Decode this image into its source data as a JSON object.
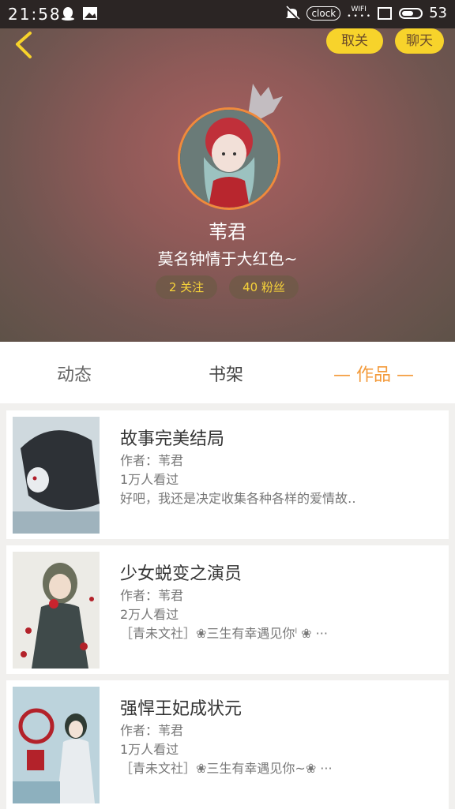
{
  "status_bar": {
    "time": "21:58",
    "clock_label": "clock",
    "wifi_label": "WIFI",
    "battery_level": "53"
  },
  "profile": {
    "unfollow_label": "取关",
    "chat_label": "聊天",
    "username": "苇君",
    "bio": "莫名钟情于大红色~",
    "following_label": "2 关注",
    "fans_label": "40 粉丝"
  },
  "tabs": [
    {
      "label": "动态"
    },
    {
      "label": "书架"
    },
    {
      "label": "— 作品 —"
    }
  ],
  "works": [
    {
      "title": "故事完美结局",
      "author": "作者：苇君",
      "views": "1万人看过",
      "desc": "好吧，我还是决定收集各种各样的爱情故‥"
    },
    {
      "title": "少女蜕变之演员",
      "author": "作者：苇君",
      "views": "2万人看过",
      "desc": "［青未文社］❀三生有幸遇见你ˡ ❀ ···"
    },
    {
      "title": "强悍王妃成状元",
      "author": "作者：苇君",
      "views": "1万人看过",
      "desc": "［青未文社］❀三生有幸遇见你~❀ ···"
    }
  ],
  "colors": {
    "accent_yellow": "#f7d32b",
    "active_tab": "#f39a3a",
    "avatar_border": "#f08a3c"
  }
}
